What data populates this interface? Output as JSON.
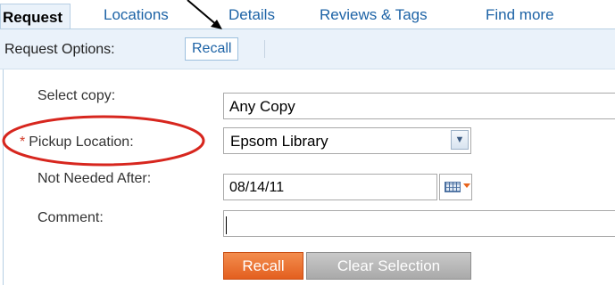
{
  "tabs": [
    {
      "label": "Request",
      "active": true
    },
    {
      "label": "Locations",
      "active": false
    },
    {
      "label": "Details",
      "active": false
    },
    {
      "label": "Reviews & Tags",
      "active": false
    },
    {
      "label": "Find more",
      "active": false
    }
  ],
  "request_options": {
    "label": "Request Options:",
    "link": "Recall"
  },
  "form": {
    "select_copy": {
      "label": "Select copy:",
      "value": "Any Copy"
    },
    "pickup_location": {
      "required_marker": "*",
      "label": "Pickup Location:",
      "value": "Epsom Library"
    },
    "not_needed_after": {
      "label": "Not Needed After:",
      "value": "08/14/11"
    },
    "comment": {
      "label": "Comment:",
      "value": ""
    }
  },
  "buttons": {
    "recall": "Recall",
    "clear": "Clear Selection"
  },
  "icons": {
    "dropdown": "chevron-down-icon",
    "calendar": "calendar-icon"
  },
  "colors": {
    "link": "#1d63a6",
    "primary_button": "#e35f1f",
    "secondary_button": "#a9a9a9",
    "annotation": "#d7261e",
    "required": "#d23c2a"
  }
}
